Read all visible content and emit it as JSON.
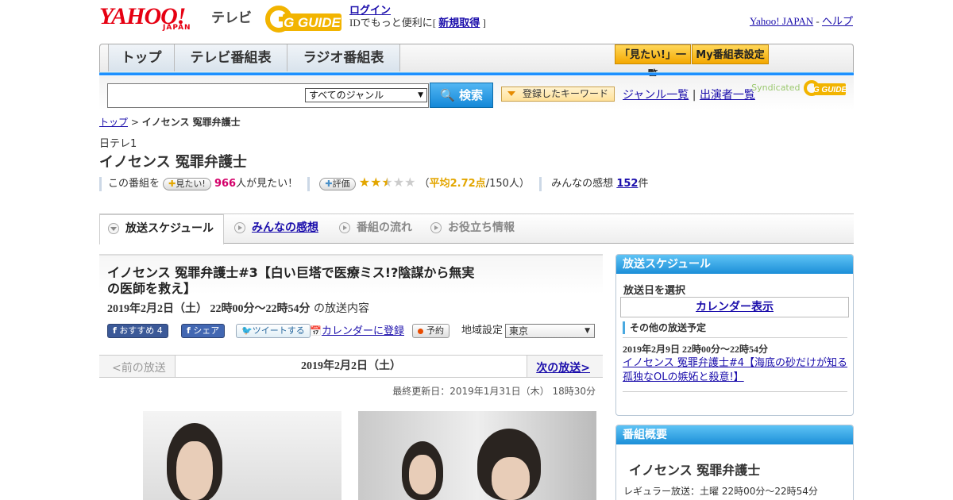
{
  "header": {
    "logo_text": "YAHOO!",
    "logo_sub": "JAPAN",
    "service": "テレビ",
    "gguide": "G GUIDE",
    "login": "ログイン",
    "login_sub_pre": "IDでもっと便利に[",
    "signup": "新規取得",
    "login_sub_post": "]",
    "yahoo_japan": "Yahoo! JAPAN",
    "link_sep": "-",
    "help": "ヘルプ"
  },
  "nav": {
    "tabs": [
      "トップ",
      "テレビ番組表",
      "ラジオ番組表"
    ],
    "want_list": "「見たい!」一覧",
    "my_schedule": "My番組表設定"
  },
  "search": {
    "input_value": "",
    "genre": "すべてのジャンル",
    "button": "検索",
    "keywords": "登録したキーワード",
    "genre_list": "ジャンル一覧",
    "divider": "|",
    "cast_list": "出演者一覧",
    "syndicated": "Syndicated"
  },
  "breadcrumb": {
    "top": "トップ",
    "sep": ">",
    "current": "イノセンス 冤罪弁護士"
  },
  "program": {
    "channel": "日テレ1",
    "title": "イノセンス 冤罪弁護士",
    "want_pre": "この番組を",
    "want_btn": "見たい!",
    "want_count": "966",
    "want_post": "人が見たい！",
    "rating_btn": "評価",
    "rating_stars": 2.72,
    "rating_open": "（",
    "rating_avg": "平均2.72点",
    "rating_count": "/150人）",
    "impressions_pre": "みんなの感想",
    "impressions_count": "152",
    "impressions_post": "件"
  },
  "content_tabs": [
    "放送スケジュール",
    "みんなの感想",
    "番組の流れ",
    "お役立ち情報"
  ],
  "episode": {
    "title": "イノセンス 冤罪弁護士#3【白い巨塔で医療ミス!?陰謀から無実の医師を救え】",
    "date": "2019年2月2日（土） 22時00分～22時54分",
    "date_suffix": "の放送内容",
    "fb_recommend": "おすすめ 4",
    "fb_share": "シェア",
    "tweet": "ツイートする",
    "calendar": "カレンダーに登録",
    "reserve": "予約",
    "area_label": "地域設定",
    "area_value": "東京"
  },
  "pager": {
    "prev": "<前の放送",
    "current": "2019年2月2日（土）",
    "next": "次の放送>"
  },
  "updated": "最終更新日：2019年1月31日（木） 18時30分",
  "sidebar": {
    "schedule_title": "放送スケジュール",
    "select_date": "放送日を選択",
    "calendar_view": "カレンダー表示",
    "other_schedules": "その他の放送予定",
    "next_date": "2019年2月9日 22時00分～22時54分",
    "next_link": "イノセンス 冤罪弁護士#4【海底の砂だけが知る孤独なOLの嫉妬と殺意!】",
    "summary_title": "番組概要",
    "summary_program": "イノセンス 冤罪弁護士",
    "regular": "レギュラー放送：土曜 22時00分～22時54分"
  },
  "colors": {
    "accent_blue": "#1e90ff",
    "brand_red": "#e60012",
    "gold": "#f4a800",
    "pink": "#d4006a"
  }
}
